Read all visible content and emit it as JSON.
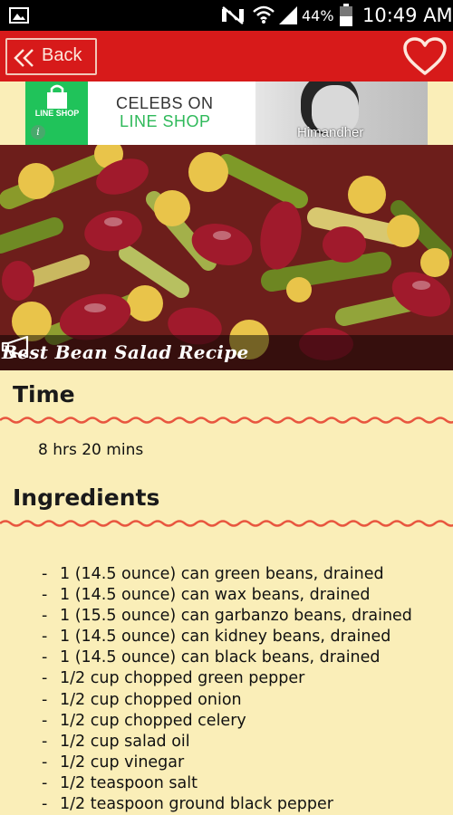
{
  "status_bar": {
    "battery_percent": "44%",
    "time": "10:49 AM",
    "icons": [
      "gallery-icon",
      "mute-icon",
      "wifi-icon",
      "signal-icon",
      "battery-icon"
    ]
  },
  "app_bar": {
    "back_label": "Back",
    "favorite_icon": "heart-outline-icon",
    "color": "#d71a1a"
  },
  "ad": {
    "logo_text": "LINE SHOP",
    "line1": "CELEBS ON",
    "line2": "LINE SHOP",
    "caption": "Himandher",
    "accent": "#20c35a"
  },
  "hero": {
    "title": "Best Bean Salad Recipe"
  },
  "time_section": {
    "heading": "Time",
    "value": "8 hrs 20 mins"
  },
  "ingredients_section": {
    "heading": "Ingredients",
    "bullet": "-",
    "items": [
      "1 (14.5 ounce) can green beans, drained",
      "1 (14.5 ounce) can wax beans, drained",
      "1 (15.5 ounce) can garbanzo beans, drained",
      "1 (14.5 ounce) can kidney beans, drained",
      "1 (14.5 ounce) can black beans, drained",
      "1/2 cup chopped green pepper",
      "1/2 cup chopped onion",
      "1/2 cup chopped celery",
      "1/2 cup salad oil",
      "1/2 cup vinegar",
      "1/2 teaspoon salt",
      "1/2 teaspoon ground black pepper"
    ]
  },
  "colors": {
    "background": "#faeeb8",
    "wavy_line": "#e8563f"
  }
}
